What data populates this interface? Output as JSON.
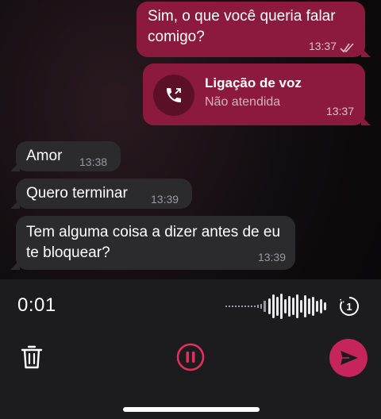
{
  "messages": [
    {
      "direction": "out",
      "text": "Sim, o que você queria falar comigo?",
      "time": "13:37",
      "status": "read"
    },
    {
      "direction": "out",
      "type": "call",
      "title": "Ligação de voz",
      "subtitle": "Não atendida",
      "time": "13:37",
      "icon": "outgoing-call-icon"
    },
    {
      "direction": "in",
      "text": "Amor",
      "time": "13:38"
    },
    {
      "direction": "in",
      "text": "Quero terminar",
      "time": "13:39"
    },
    {
      "direction": "in",
      "text": "Tem alguma coisa a dizer antes de eu te bloquear?",
      "time": "13:39"
    }
  ],
  "recorder": {
    "elapsed": "0:01",
    "view_once_label": "1",
    "icons": [
      "waveform-icon",
      "view-once-icon",
      "trash-icon",
      "pause-icon",
      "send-icon"
    ]
  },
  "colors": {
    "outgoing_bubble": "#8b1a3e",
    "incoming_bubble": "#2b2b2d",
    "accent": "#c5255a",
    "recorder_bar": "#1c1c1e"
  }
}
